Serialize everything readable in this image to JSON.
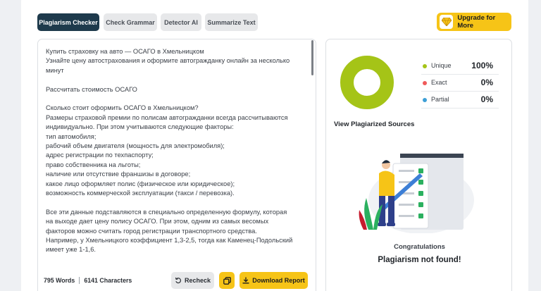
{
  "tabs": [
    {
      "label": "Plagiarism Checker",
      "active": true
    },
    {
      "label": "Check Grammar",
      "active": false
    },
    {
      "label": "Detector AI",
      "active": false
    },
    {
      "label": "Summarize Text",
      "active": false
    }
  ],
  "upgrade": {
    "label": "Upgrade for More",
    "icon": "diamond-icon"
  },
  "editor": {
    "lines": [
      "Купить страховку на авто — ОСАГО в Хмельницком",
      "Узнайте цену автострахования и оформите автогражданку онлайн за несколько",
      "минут",
      "",
      "Рассчитать стоимость ОСАГО",
      "",
      "Сколько стоит оформить ОСАГО в Хмельницком?",
      "Размеры страховой премии по полисам автогражданки всегда рассчитываются",
      "индивидуально. При этом учитываются следующие факторы:",
      "тип автомобиля;",
      "рабочий объем двигателя (мощность для электромобиля);",
      "адрес регистрации по техпаспорту;",
      "право собственника на льготы;",
      "наличие или отсутствие франшизы в договоре;",
      "какое лицо оформляет полис (физическое или юридическое);",
      "возможность коммерческой эксплуатации (такси / перевозка).",
      "",
      "Все эти данные подставляются в специально определенную формулу, которая",
      "на выходе дает цену полису ОСАГО. При этом, одним из самых весомых",
      "факторов можно считать город регистрации транспортного средства.",
      "Например, у Хмельницкого коэффициент 1,3-2,5, тогда как Каменец-Подольский",
      "имеет уже 1-1,6."
    ]
  },
  "stats": {
    "words": "795 Words",
    "characters": "6141 Characters"
  },
  "actions": {
    "recheck_label": "Recheck",
    "download_label": "Download Report"
  },
  "results": {
    "legend": [
      {
        "label": "Unique",
        "value": "100%",
        "color": "#a5c417"
      },
      {
        "label": "Exact",
        "value": "0%",
        "color": "#ef5a5a"
      },
      {
        "label": "Partial",
        "value": "0%",
        "color": "#3d9fd6"
      }
    ],
    "unique_fraction": 1.0,
    "donut_color": "#a5c417",
    "view_sources_label": "View Plagiarized Sources",
    "congrats_title": "Congratulations",
    "congrats_message": "Plagiarism not found!"
  },
  "colors": {
    "accent": "#f6c417",
    "primary": "#1e3a4c"
  }
}
